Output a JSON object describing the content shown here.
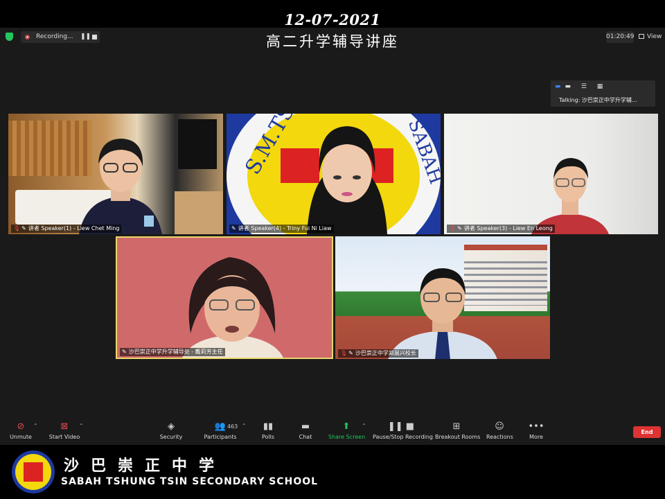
{
  "banner": {
    "date": "12-07-2021",
    "title": "高二升学辅导讲座"
  },
  "top_bar": {
    "recording_label": "Recording...",
    "pause_glyph": "❚❚",
    "timer": "01:20:49",
    "view_label": "View"
  },
  "talking_indicator": {
    "text": "Talking: 沙巴崇正中学升学辅..."
  },
  "participants": [
    {
      "name": "讲者 Speaker(1) - Liew Chet Ming",
      "muted": true
    },
    {
      "name": "讲者 Speaker(4) - Triny Fui Ni Liaw",
      "muted": false
    },
    {
      "name": "讲者 Speaker(3) - Liew En Leong",
      "muted": true
    },
    {
      "name": "沙巴崇正中学升学辅导处 - 戴莉芳主任",
      "muted": false
    },
    {
      "name": "沙巴崇正中学郑展兴校长",
      "muted": true
    }
  ],
  "toolbar": {
    "unmute": "Unmute",
    "start_video": "Start Video",
    "security": "Security",
    "participants": "Participants",
    "participant_count": "463",
    "polls": "Polls",
    "chat": "Chat",
    "share_screen": "Share Screen",
    "pause_stop_recording": "Pause/Stop Recording",
    "breakout_rooms": "Breakout Rooms",
    "reactions": "Reactions",
    "more": "More",
    "end": "End"
  },
  "school": {
    "name_cn": "沙巴崇正中学",
    "name_en": "SABAH TSHUNG TSIN SECONDARY SCHOOL",
    "logo_ring_text": "S.M.TSHUNG TSIN SABAH",
    "logo_bottom_text": "沙巴崇正中学"
  },
  "colors": {
    "accent_green": "#22c55e",
    "end_red": "#dd3333",
    "active_speaker_border": "#e8d76b",
    "toolbar_bg": "#1a1a1a"
  },
  "icons": {
    "shield": "shield-icon",
    "mic_muted": "microphone-off-icon",
    "video_off": "video-off-icon",
    "security": "shield-icon",
    "participants": "people-icon",
    "polls": "bar-chart-icon",
    "chat": "chat-bubble-icon",
    "share": "share-arrow-icon",
    "recording": "pause-stop-icon",
    "breakout": "grid-icon",
    "reactions": "emoji-plus-icon",
    "more": "ellipsis-icon"
  }
}
